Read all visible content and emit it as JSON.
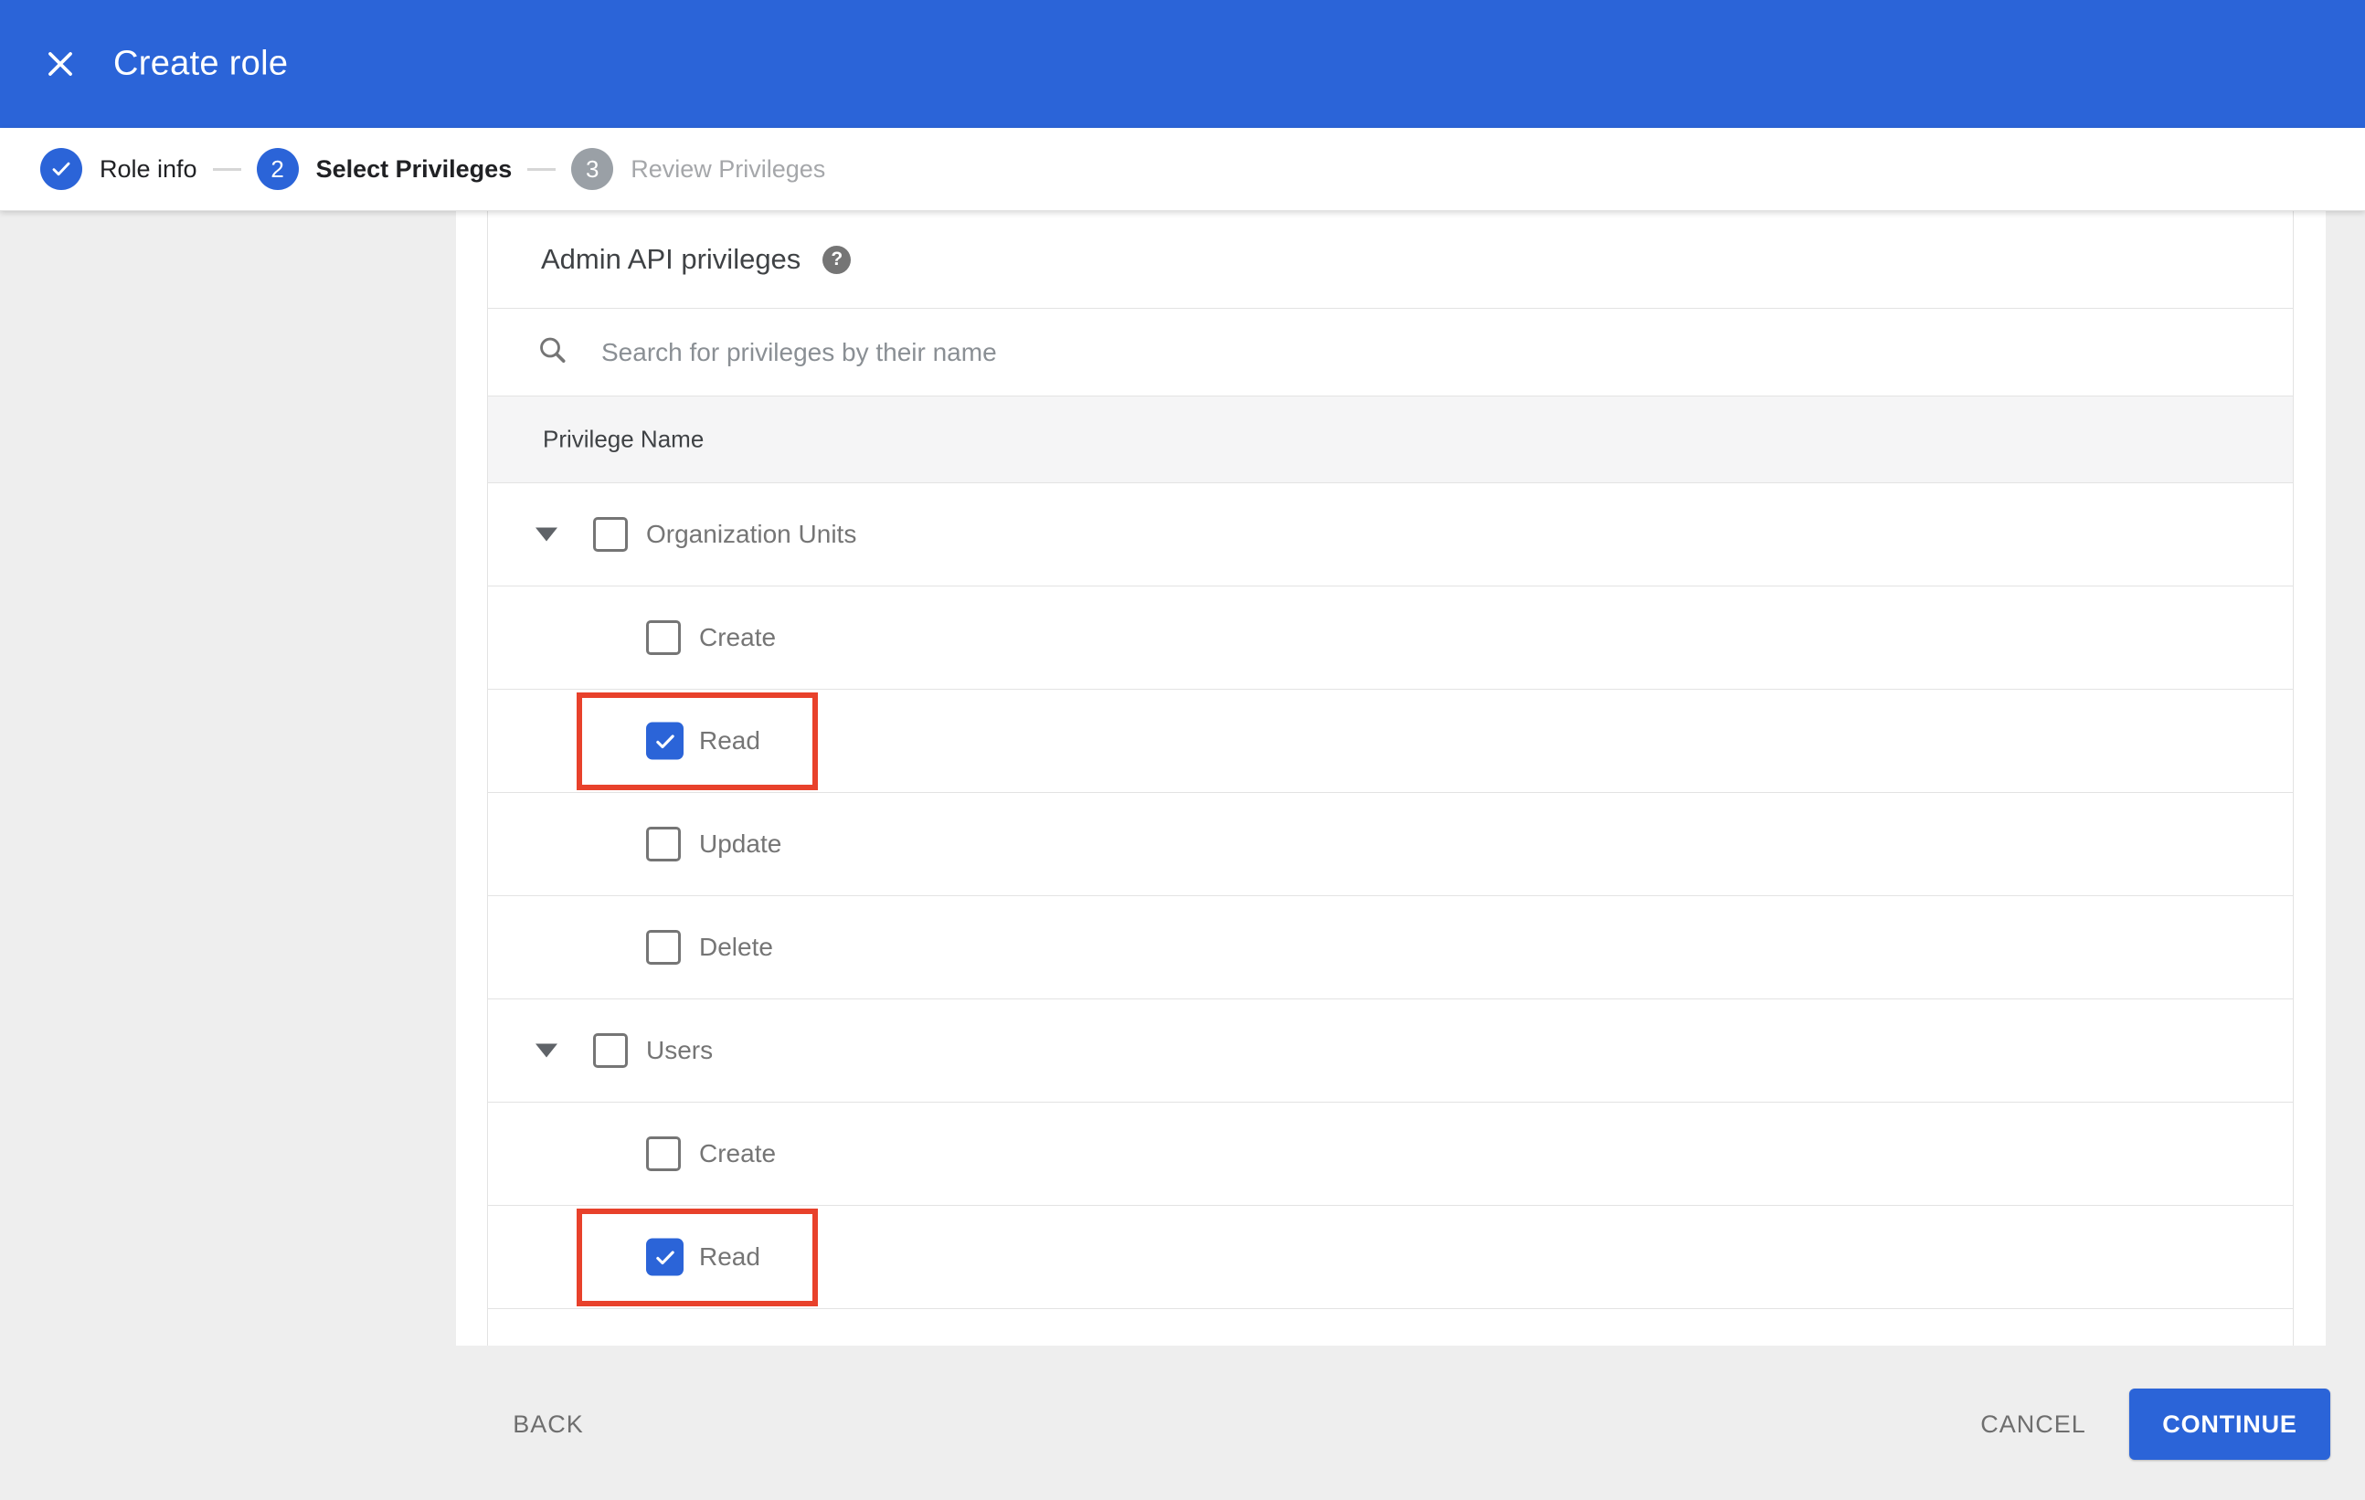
{
  "appbar": {
    "title": "Create role",
    "close_icon": "close-x-icon"
  },
  "stepper": {
    "steps": [
      {
        "num": "",
        "label": "Role info",
        "state": "done",
        "icon": "checkmark-icon"
      },
      {
        "num": "2",
        "label": "Select Privileges",
        "state": "active"
      },
      {
        "num": "3",
        "label": "Review Privileges",
        "state": "upcoming"
      }
    ]
  },
  "content": {
    "heading": "Admin API privileges",
    "help_icon": "help-question-icon",
    "search": {
      "icon": "magnifier-icon",
      "placeholder": "Search for privileges by their name",
      "value": ""
    },
    "table": {
      "header": "Privilege Name",
      "groups": [
        {
          "label": "Organization Units",
          "checked": false,
          "expanded": true,
          "children": [
            {
              "label": "Create",
              "checked": false,
              "highlighted": false
            },
            {
              "label": "Read",
              "checked": true,
              "highlighted": true
            },
            {
              "label": "Update",
              "checked": false,
              "highlighted": false
            },
            {
              "label": "Delete",
              "checked": false,
              "highlighted": false
            }
          ]
        },
        {
          "label": "Users",
          "checked": false,
          "expanded": true,
          "children": [
            {
              "label": "Create",
              "checked": false,
              "highlighted": false
            },
            {
              "label": "Read",
              "checked": true,
              "highlighted": true
            }
          ]
        }
      ]
    }
  },
  "footer": {
    "back": "BACK",
    "cancel": "CANCEL",
    "continue": "CONTINUE"
  },
  "colors": {
    "accent_blue": "#2b64d8",
    "annotation_red": "#e8412b",
    "step_inactive_gray": "#9aa0a6",
    "divider": "#e3e3e3",
    "header_row_bg": "#f5f5f6",
    "page_gray": "#eeeeee",
    "label_gray": "#757575"
  }
}
